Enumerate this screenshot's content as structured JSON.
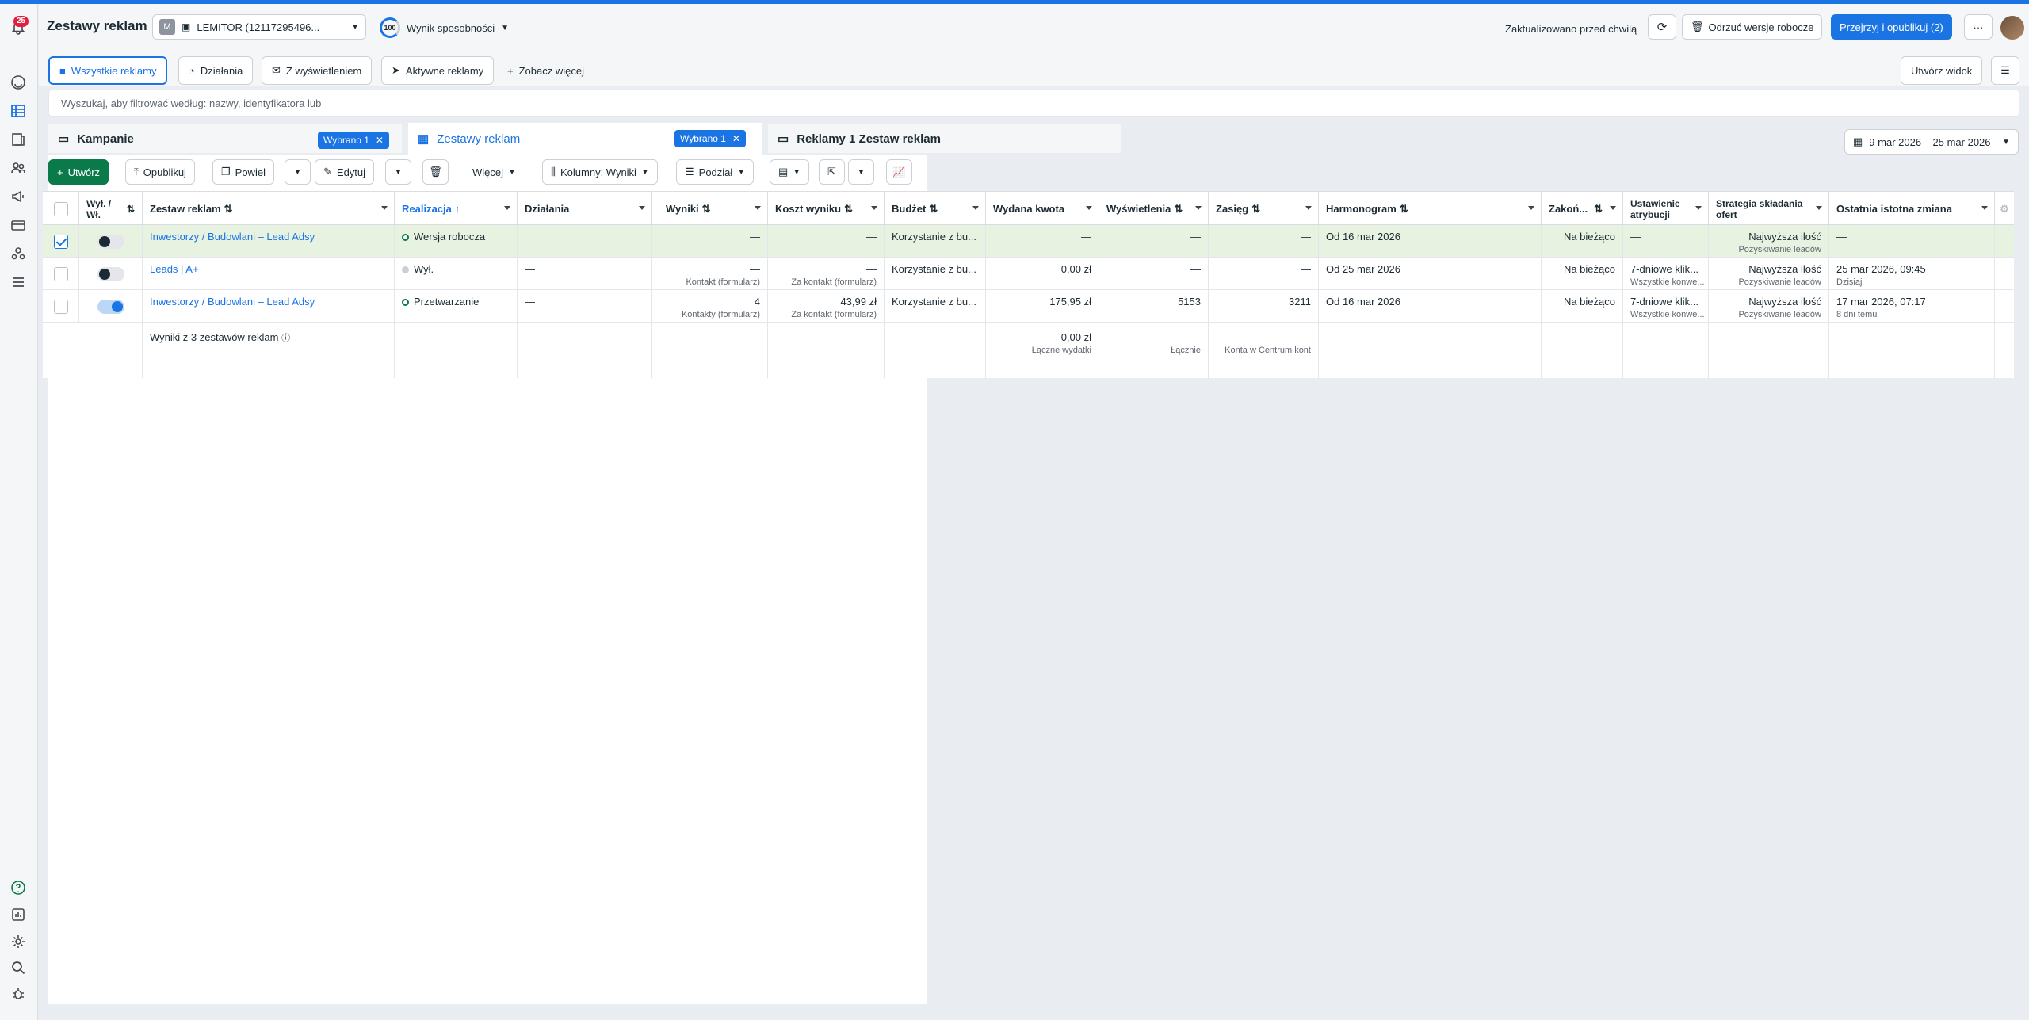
{
  "notifications": {
    "count": "25"
  },
  "header": {
    "title": "Zestawy reklam",
    "account_badge": "M",
    "account_name": "LEMITOR (12117295496...",
    "opportunity_score": "100",
    "opportunity_label": "Wynik sposobności",
    "updated_text": "Zaktualizowano przed chwilą",
    "discard_label": "Odrzuć wersje robocze",
    "publish_label": "Przejrzyj i opublikuj (2)",
    "more_label": "···"
  },
  "tabs": {
    "all_ads": "Wszystkie reklamy",
    "actions": "Działania",
    "with_impressions": "Z wyświetleniem",
    "active_ads": "Aktywne reklamy",
    "see_more": "Zobacz więcej",
    "create_view": "Utwórz widok"
  },
  "search": {
    "placeholder": "Wyszukaj, aby filtrować według: nazwy, identyfikatora lub"
  },
  "levels": {
    "campaigns": "Kampanie",
    "campaigns_chip": "Wybrano 1",
    "adsets": "Zestawy reklam",
    "adsets_chip": "Wybrano 1",
    "ads": "Reklamy 1 Zestaw reklam"
  },
  "date_range": "9 mar 2026 – 25 mar 2026",
  "toolbar": {
    "create": "Utwórz",
    "publish": "Opublikuj",
    "duplicate": "Powiel",
    "edit": "Edytuj",
    "more": "Więcej",
    "columns": "Kolumny: Wyniki",
    "breakdown": "Podział"
  },
  "columns": {
    "onoff": "Wył. / Wł.",
    "adset": "Zestaw reklam",
    "delivery": "Realizacja",
    "actions": "Działania",
    "results": "Wyniki",
    "cost": "Koszt wyniku",
    "budget": "Budżet",
    "spent": "Wydana kwota",
    "impressions": "Wyświetlenia",
    "reach": "Zasięg",
    "schedule": "Harmonogram",
    "ends": "Zakoń...",
    "attribution": "Ustawienie atrybucji",
    "bid": "Strategia składania ofert",
    "last_change": "Ostatnia istotna zmiana"
  },
  "rows": [
    {
      "name": "Inwestorzy / Budowlani – Lead Adsy",
      "delivery": "Wersja robocza",
      "actions": "",
      "results": "—",
      "results_sub": "",
      "cost": "—",
      "cost_sub": "",
      "budget": "Korzystanie z bu...",
      "spent": "—",
      "impressions": "—",
      "reach": "—",
      "schedule": "Od 16 mar 2026",
      "ends": "Na bieżąco",
      "attribution": "—",
      "attribution_sub": "",
      "bid": "Najwyższa ilość",
      "bid_sub": "Pozyskiwanie leadów",
      "last_change": "—",
      "last_change_sub": ""
    },
    {
      "name": "Leads | A+",
      "delivery": "Wył.",
      "actions": "—",
      "results": "—",
      "results_sub": "Kontakt (formularz)",
      "cost": "—",
      "cost_sub": "Za kontakt (formularz)",
      "budget": "Korzystanie z bu...",
      "spent": "0,00 zł",
      "impressions": "—",
      "reach": "—",
      "schedule": "Od 25 mar 2026",
      "ends": "Na bieżąco",
      "attribution": "7-dniowe klik...",
      "attribution_sub": "Wszystkie konwe...",
      "bid": "Najwyższa ilość",
      "bid_sub": "Pozyskiwanie leadów",
      "last_change": "25 mar 2026, 09:45",
      "last_change_sub": "Dzisiaj"
    },
    {
      "name": "Inwestorzy / Budowlani – Lead Adsy",
      "delivery": "Przetwarzanie",
      "actions": "—",
      "results": "4",
      "results_sub": "Kontakty (formularz)",
      "cost": "43,99 zł",
      "cost_sub": "Za kontakt (formularz)",
      "budget": "Korzystanie z bu...",
      "spent": "175,95 zł",
      "impressions": "5153",
      "reach": "3211",
      "schedule": "Od 16 mar 2026",
      "ends": "Na bieżąco",
      "attribution": "7-dniowe klik...",
      "attribution_sub": "Wszystkie konwe...",
      "bid": "Najwyższa ilość",
      "bid_sub": "Pozyskiwanie leadów",
      "last_change": "17 mar 2026, 07:17",
      "last_change_sub": "8 dni temu"
    }
  ],
  "totals": {
    "label": "Wyniki z 3 zestawów reklam",
    "results": "—",
    "cost": "—",
    "spent": "0,00 zł",
    "spent_sub": "Łączne wydatki",
    "impressions": "—",
    "impressions_sub": "Łącznie",
    "reach": "—",
    "reach_sub": "Konta w Centrum kont",
    "attribution": "—",
    "last_change": "—"
  }
}
